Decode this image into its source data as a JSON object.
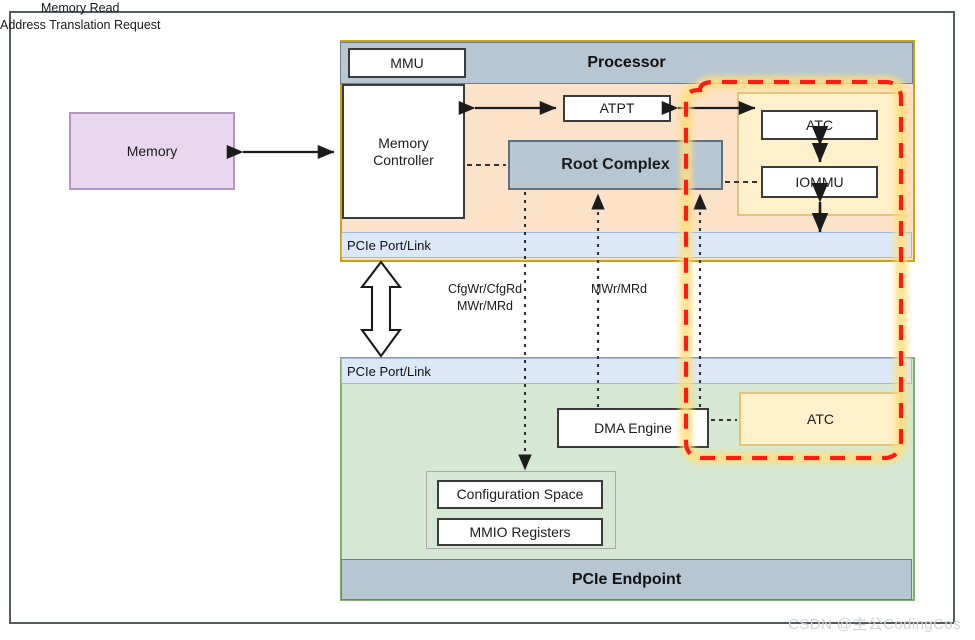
{
  "diagram": {
    "title_watermark": "CSDN @主公CodingCos",
    "memory": {
      "label": "Memory"
    },
    "processor": {
      "title": "Processor",
      "mmu": "MMU",
      "memory_controller": "Memory\nController",
      "atpt": "ATPT",
      "root_complex": "Root Complex",
      "atc": "ATC",
      "iommu": "IOMMU",
      "pcie_port_link": "PCIe Port/Link"
    },
    "endpoint": {
      "title": "PCIe Endpoint",
      "pcie_port_link": "PCIe Port/Link",
      "dma_engine": "DMA Engine",
      "atc": "ATC",
      "configuration_space": "Configuration Space",
      "mmio_registers": "MMIO Registers"
    },
    "link_labels": {
      "cfg": "CfgWr/CfgRd\nMWr/MRd",
      "mwr": "MWr/MRd",
      "memread": "Memory Read\nAddress Translation Request"
    },
    "colors": {
      "processor_band": "#b6c6d3",
      "processor_body": "#fbe2c8",
      "processor_border": "#c8a317",
      "endpoint_body": "#d5e8d4",
      "endpoint_border": "#7fae6f",
      "pcie_port_link": "#dce8f7",
      "memory_fill": "#e9d7ef",
      "memory_border": "#b494c4",
      "atc_fill": "#fdf0cb",
      "atc_border": "#e3c37a",
      "highlight_dashed": "#ff0000",
      "highlight_glow": "#ffe9a8",
      "box_fill": "#ffffff",
      "box_border": "#3b3b3b"
    }
  }
}
